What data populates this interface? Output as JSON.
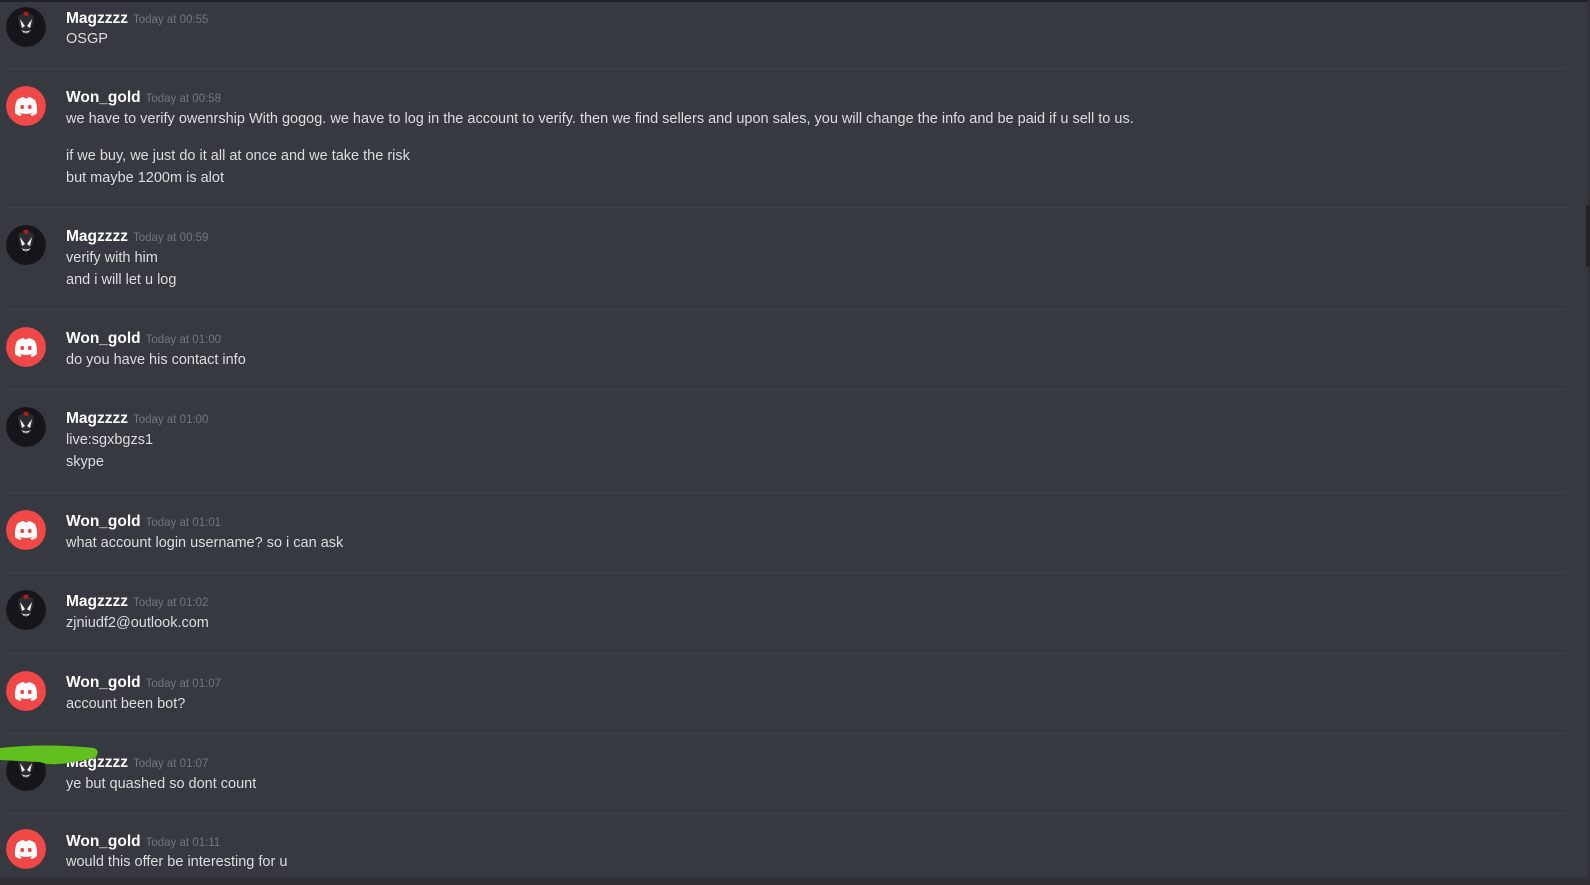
{
  "messages": [
    {
      "author": "Magzzzz",
      "timestamp": "Today at 00:55",
      "avatar_icon": "venom-avatar-icon",
      "lines": [
        "OSGP"
      ]
    },
    {
      "author": "Won_gold",
      "timestamp": "Today at 00:58",
      "avatar_icon": "discord-avatar-icon",
      "lines": [
        "we have to verify owenrship With gogog. we have to log in the account to verify. then we find sellers and upon sales, you will change the info and be paid if u sell to us.",
        "if we buy, we just do it all at once and we take the risk",
        "but maybe 1200m is alot"
      ]
    },
    {
      "author": "Magzzzz",
      "timestamp": "Today at 00:59",
      "avatar_icon": "venom-avatar-icon",
      "lines": [
        "verify with him",
        "and i will let u log"
      ]
    },
    {
      "author": "Won_gold",
      "timestamp": "Today at 01:00",
      "avatar_icon": "discord-avatar-icon",
      "lines": [
        "do you have his contact info"
      ]
    },
    {
      "author": "Magzzzz",
      "timestamp": "Today at 01:00",
      "avatar_icon": "venom-avatar-icon",
      "lines": [
        "live:sgxbgzs1",
        "skype"
      ]
    },
    {
      "author": "Won_gold",
      "timestamp": "Today at 01:01",
      "avatar_icon": "discord-avatar-icon",
      "lines": [
        "what account login username? so i can ask"
      ]
    },
    {
      "author": "Magzzzz",
      "timestamp": "Today at 01:02",
      "avatar_icon": "venom-avatar-icon",
      "lines": [
        "zjniudf2@outlook.com"
      ]
    },
    {
      "author": "Won_gold",
      "timestamp": "Today at 01:07",
      "avatar_icon": "discord-avatar-icon",
      "lines": [
        "account been bot?"
      ]
    },
    {
      "author": "Magzzzz",
      "timestamp": "Today at 01:07",
      "avatar_icon": "venom-avatar-icon",
      "lines": [
        "ye but quashed so dont count"
      ]
    },
    {
      "author": "Won_gold",
      "timestamp": "Today at 01:11",
      "avatar_icon": "discord-avatar-icon",
      "lines": [
        "would this offer be interesting for u"
      ]
    }
  ],
  "colors": {
    "background": "#36393f",
    "username": "#ffffff",
    "timestamp": "#72767d",
    "message_text": "#dcddde",
    "discord_avatar": "#f04747",
    "redaction_scribble": "#62c01e"
  }
}
